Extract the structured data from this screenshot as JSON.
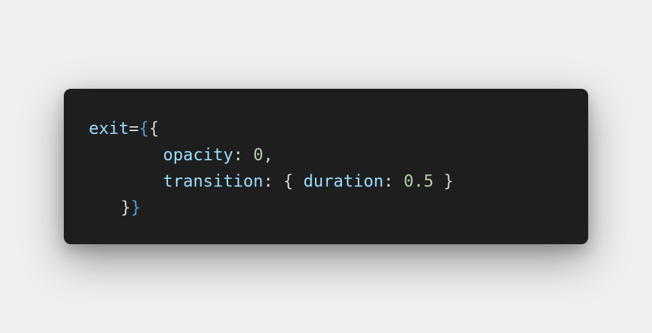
{
  "code": {
    "line1": {
      "attr": "exit",
      "eq": "=",
      "open_jsx": "{",
      "open_obj": "{"
    },
    "line2": {
      "key": "opacity",
      "colon": ": ",
      "value": "0",
      "comma": ","
    },
    "line3": {
      "key": "transition",
      "colon": ": ",
      "open": "{ ",
      "inner_key": "duration",
      "inner_colon": ": ",
      "inner_value": "0.5",
      "close": " }"
    },
    "line4": {
      "close_obj": "}",
      "close_jsx": "}"
    }
  },
  "colors": {
    "background": "#efefef",
    "editor_background": "#1e1e1e",
    "property": "#9cdcfe",
    "number": "#b5cea8",
    "jsx_brace": "#569cd6",
    "punctuation": "#d4d4d4"
  }
}
